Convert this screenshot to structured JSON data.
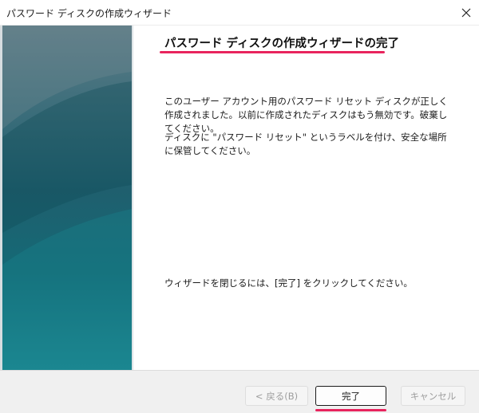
{
  "window": {
    "title": "パスワード ディスクの作成ウィザード",
    "close_icon": "close-icon"
  },
  "content": {
    "heading": "パスワード ディスクの作成ウィザードの完了",
    "paragraph1": "このユーザー アカウント用のパスワード リセット ディスクが正しく作成されました。以前に作成されたディスクはもう無効です。破棄してください。",
    "paragraph2": "ディスクに \"パスワード リセット\" というラベルを付け、安全な場所に保管してください。",
    "paragraph3": "ウィザードを閉じるには、[完了] をクリックしてください。"
  },
  "buttons": {
    "back_label": "< 戻る(B)",
    "finish_label": "完了",
    "cancel_label": "キャンセル"
  },
  "colors": {
    "highlight": "#e8245d",
    "banner_top": "#5e7c86",
    "banner_bottom": "#1d8a94"
  }
}
